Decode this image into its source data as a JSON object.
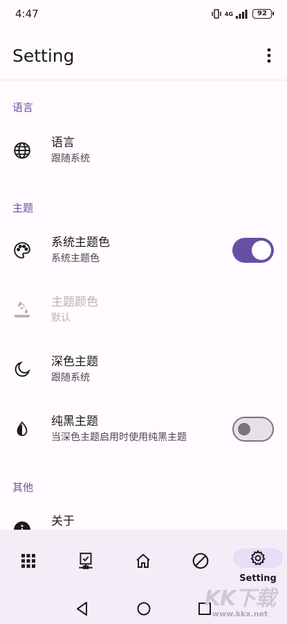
{
  "status_bar": {
    "time": "4:47",
    "network": "4G",
    "battery": "92"
  },
  "app_bar": {
    "title": "Setting",
    "more_icon": "more-vert-icon"
  },
  "sections": {
    "language": {
      "header": "语言"
    },
    "theme": {
      "header": "主题"
    },
    "other": {
      "header": "其他"
    }
  },
  "rows": {
    "language": {
      "title": "语言",
      "subtitle": "跟随系统",
      "icon": "globe-icon"
    },
    "system_theme_color": {
      "title": "系统主题色",
      "subtitle": "系统主题色",
      "icon": "palette-icon",
      "toggle": true
    },
    "theme_color": {
      "title": "主题颜色",
      "subtitle": "默认",
      "icon": "format-color-fill-icon",
      "disabled": true
    },
    "dark_theme": {
      "title": "深色主题",
      "subtitle": "跟随系统",
      "icon": "moon-icon"
    },
    "pure_black": {
      "title": "纯黑主题",
      "subtitle": "当深色主题启用时使用纯黑主题",
      "icon": "contrast-icon",
      "toggle": false
    },
    "about": {
      "title": "关于",
      "icon": "info-icon"
    }
  },
  "bottom_nav": {
    "items": [
      {
        "icon": "apps-grid-icon"
      },
      {
        "icon": "device-check-icon"
      },
      {
        "icon": "home-icon"
      },
      {
        "icon": "block-icon"
      },
      {
        "icon": "gear-icon",
        "label": "Setting",
        "active": true
      }
    ]
  },
  "watermark": {
    "logo": "KK下载",
    "url": "www.kkx.net"
  },
  "colors": {
    "accent": "#6750a4",
    "nav_bg": "#f3edf7",
    "active_pill": "#e8def8"
  }
}
